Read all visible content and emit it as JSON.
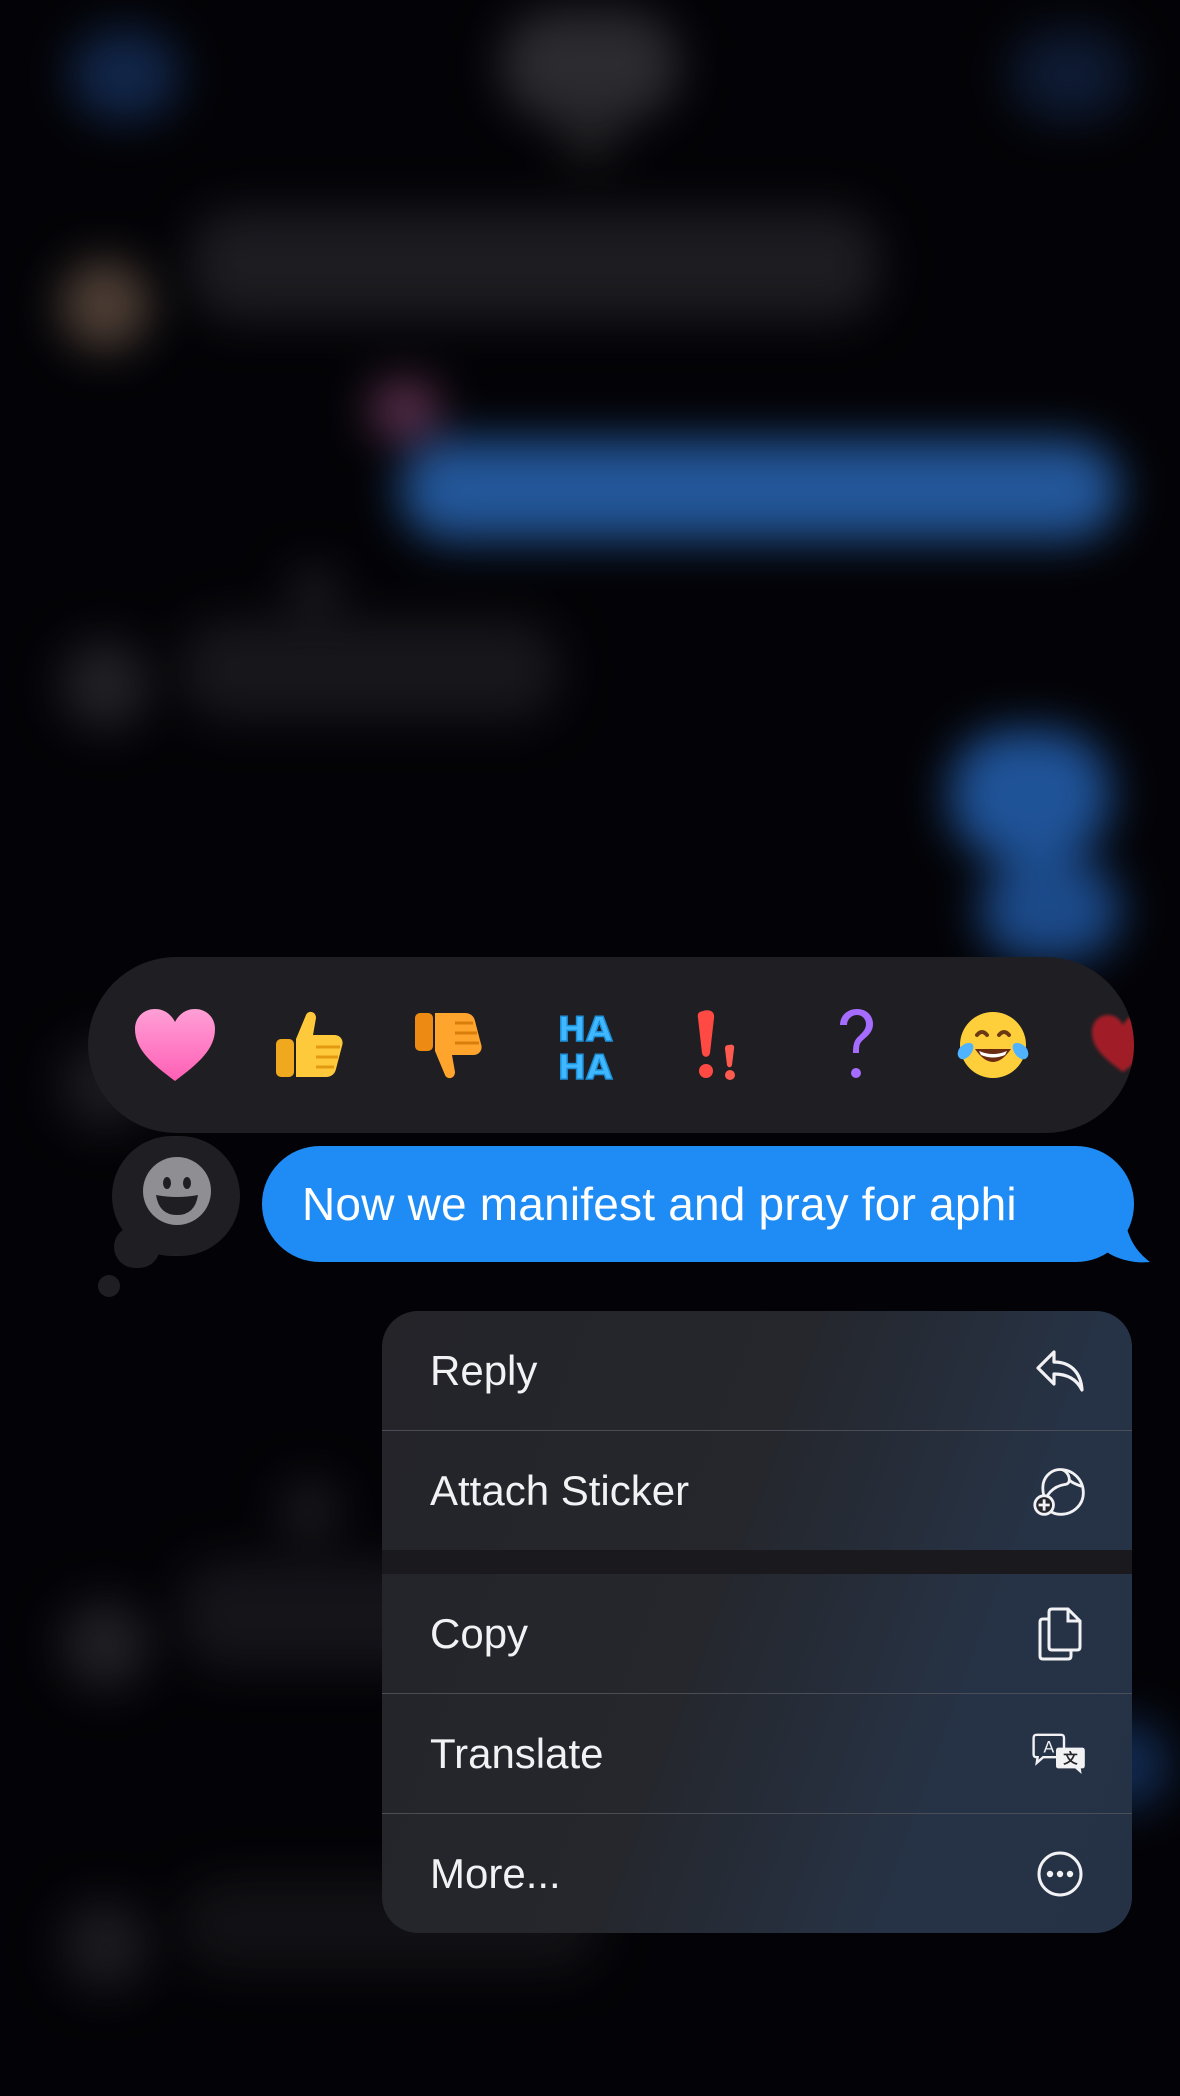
{
  "message": {
    "text": "Now we manifest and pray for aphi",
    "bubble_color": "#1f8cf5"
  },
  "tapback": {
    "reactions": [
      {
        "name": "heart",
        "icon": "heart-icon"
      },
      {
        "name": "thumbs up",
        "icon": "thumbs-up-icon"
      },
      {
        "name": "thumbs down",
        "icon": "thumbs-down-icon"
      },
      {
        "name": "haha",
        "icon": "haha-icon",
        "text": "HA HA"
      },
      {
        "name": "emphasize",
        "icon": "exclamation-icon"
      },
      {
        "name": "question",
        "icon": "question-icon"
      },
      {
        "name": "laughing with tears",
        "icon": "tears-of-joy-icon"
      },
      {
        "name": "more emoji",
        "icon": "red-heart-icon"
      }
    ],
    "sticker_icon": "smiley-sticker-icon"
  },
  "context_menu": {
    "items": [
      {
        "label": "Reply",
        "icon": "reply-arrow-icon"
      },
      {
        "label": "Attach Sticker",
        "icon": "sticker-plus-icon"
      },
      {
        "label": "Copy",
        "icon": "copy-documents-icon"
      },
      {
        "label": "Translate",
        "icon": "translate-bubbles-icon"
      },
      {
        "label": "More...",
        "icon": "ellipsis-circle-icon"
      }
    ]
  },
  "colors": {
    "background": "#05050a",
    "menu_background": "#242429",
    "tapback_background": "#1f1f23"
  }
}
